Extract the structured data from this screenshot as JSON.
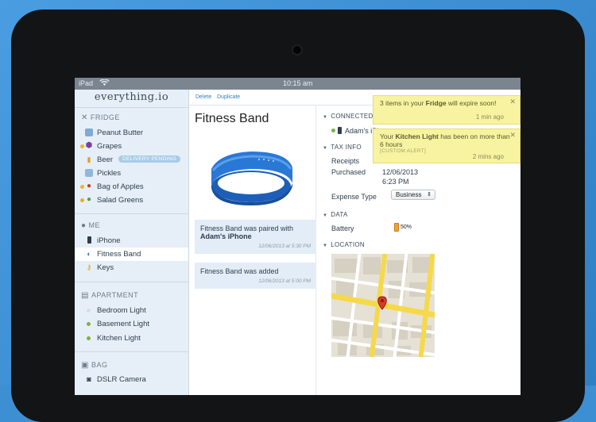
{
  "status": {
    "device": "iPad",
    "time": "10:15 am"
  },
  "app": {
    "logo": "everything.io"
  },
  "sidebar": {
    "fridge": {
      "header": "FRIDGE",
      "items": [
        {
          "label": "Peanut Butter",
          "dot": "",
          "icon": "jar-icon"
        },
        {
          "label": "Grapes",
          "dot": "#f0b429",
          "icon": "grapes-icon"
        },
        {
          "label": "Beer",
          "dot": "",
          "icon": "beer-icon",
          "badge": "DELIVERY PENDING"
        },
        {
          "label": "Pickles",
          "dot": "",
          "icon": "jar-icon"
        },
        {
          "label": "Bag of Apples",
          "dot": "#f0b429",
          "icon": "apple-icon"
        },
        {
          "label": "Salad Greens",
          "dot": "#e8b020",
          "icon": "greens-icon"
        }
      ]
    },
    "me": {
      "header": "ME",
      "items": [
        {
          "label": "iPhone",
          "icon": "phone-icon"
        },
        {
          "label": "Fitness Band",
          "icon": "band-icon",
          "selected": true
        },
        {
          "label": "Keys",
          "icon": "key-icon"
        }
      ]
    },
    "apartment": {
      "header": "APARTMENT",
      "items": [
        {
          "label": "Bedroom Light",
          "dot": "#d9dde0"
        },
        {
          "label": "Basement Light",
          "dot": "#7cb342"
        },
        {
          "label": "Kitchen Light",
          "dot": "#7cb342"
        }
      ]
    },
    "bag": {
      "header": "BAG",
      "items": [
        {
          "label": "DSLR Camera",
          "icon": "camera-icon"
        }
      ]
    }
  },
  "toolbar": {
    "delete": "Delete",
    "duplicate": "Duplicate"
  },
  "detail": {
    "title": "Fitness Band",
    "log": [
      {
        "text_before": "Fitness Band was paired with ",
        "bold": "Adam's iPhone",
        "time": "12/06/2013 at 5:30 PM"
      },
      {
        "text_before": "Fitness Band was added",
        "bold": "",
        "time": "12/06/2013 at 5:00 PM"
      }
    ]
  },
  "info": {
    "connected": {
      "header": "CONNECTED DEVICES",
      "device": "Adam's iPhone"
    },
    "tax": {
      "header": "TAX INFO",
      "receipts_label": "Receipts",
      "purchased_label": "Purchased",
      "purchased_date": "12/06/2013",
      "purchased_time": "6:23 PM",
      "expense_label": "Expense Type",
      "expense_value": "Business"
    },
    "data": {
      "header": "DATA",
      "battery_label": "Battery",
      "battery_value": "50%",
      "battery_level": 0.5
    },
    "location": {
      "header": "LOCATION"
    }
  },
  "alerts": [
    {
      "before": "3 items in your ",
      "bold": "Fridge",
      "after": " will expire soon!",
      "time": "1 min ago"
    },
    {
      "before": "Your ",
      "bold": "Kitchen Light",
      "after": " has been on more than 6 hours",
      "tag": "[CUSTOM ALERT]",
      "time": "2 mins ago"
    }
  ]
}
